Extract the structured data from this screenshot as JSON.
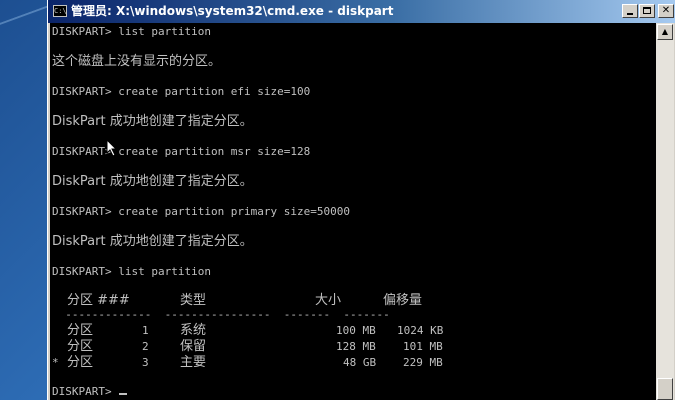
{
  "window": {
    "title": "管理员: X:\\windows\\system32\\cmd.exe - diskpart",
    "icon_text": "C:\\",
    "minimize_icon": "minimize-icon",
    "maximize_icon": "maximize-icon",
    "close_label": "✕"
  },
  "console": {
    "lines": [
      "DISKPART> list partition",
      "这个磁盘上没有显示的分区。",
      "DISKPART> create partition efi size=100",
      "DiskPart 成功地创建了指定分区。",
      "DISKPART> create partition msr size=128",
      "DiskPart 成功地创建了指定分区。",
      "DISKPART> create partition primary size=50000",
      "DiskPart 成功地创建了指定分区。",
      "DISKPART> list partition"
    ],
    "table": {
      "headers": {
        "partition": "分区 ###",
        "type": "类型",
        "size": "大小",
        "offset": "偏移量"
      },
      "separator": "  -------------  ----------------  -------  -------",
      "rows": [
        {
          "marker": " ",
          "label": "分区",
          "num": "1",
          "type": "系统",
          "size": "100 MB",
          "offset": "1024 KB"
        },
        {
          "marker": " ",
          "label": "分区",
          "num": "2",
          "type": "保留",
          "size": "128 MB",
          "offset": "101 MB"
        },
        {
          "marker": "*",
          "label": "分区",
          "num": "3",
          "type": "主要",
          "size": "48 GB",
          "offset": "229 MB"
        }
      ]
    },
    "prompt": "DISKPART> "
  },
  "scrollbar": {
    "up_arrow": "▲"
  },
  "colors": {
    "console_bg": "#000000",
    "console_text": "#c0c0c0",
    "title_start": "#0a246a",
    "title_end": "#a6caf0"
  }
}
